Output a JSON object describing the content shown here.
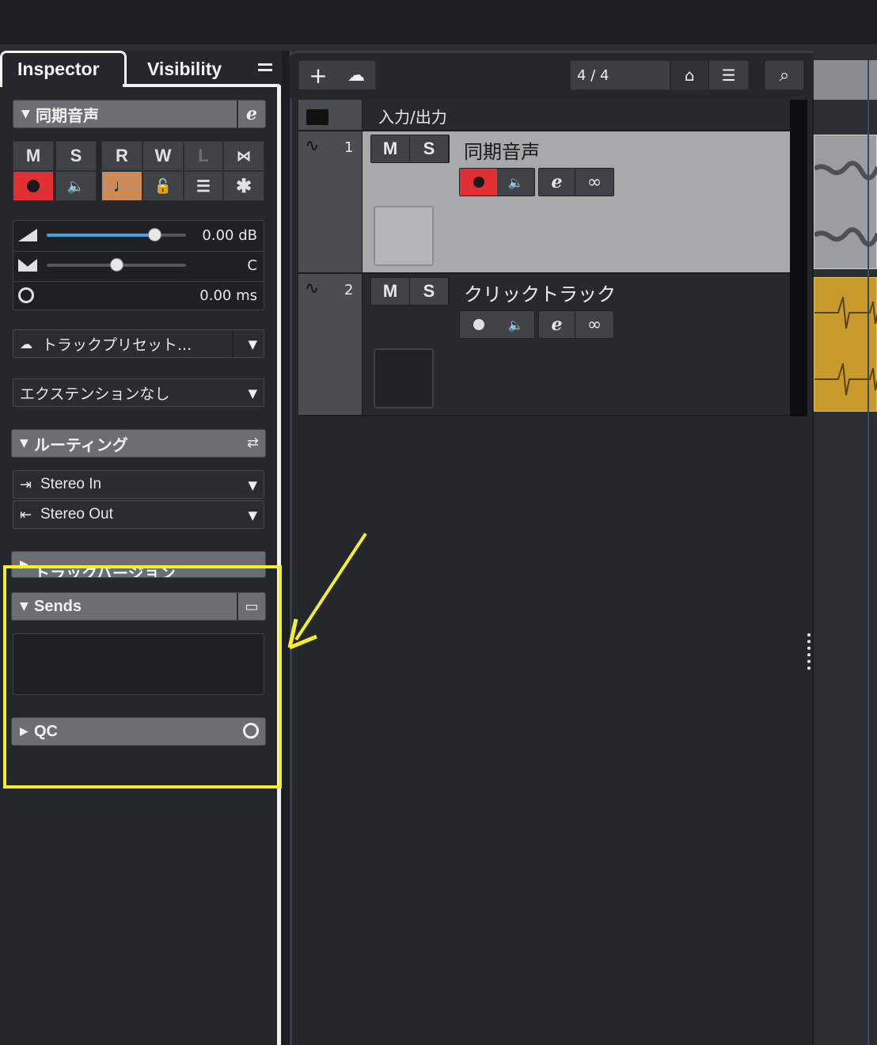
{
  "inspector": {
    "tabs": [
      {
        "label": "Inspector"
      },
      {
        "label": "Visibility"
      }
    ],
    "track_name": "同期音声",
    "buttons_top": [
      "M",
      "S",
      "R",
      "W",
      "L"
    ],
    "volume": "0.00 dB",
    "pan": "C",
    "delay": "0.00 ms",
    "volume_level": 0.77,
    "pan_level": 0.5,
    "track_preset": "トラックプリセット...",
    "extension": "エクステンションなし",
    "routing": {
      "title": "ルーティング",
      "input": "Stereo In",
      "output": "Stereo Out"
    },
    "track_versions": "トラックバージョン",
    "sends": "Sends",
    "qc": "QC"
  },
  "project": {
    "signature": "4 / 4",
    "folder_track": "入力/出力",
    "tracks": [
      {
        "number": "1",
        "name": "同期音声",
        "selected": true
      },
      {
        "number": "2",
        "name": "クリックトラック",
        "selected": false
      }
    ],
    "ms": [
      "M",
      "S"
    ]
  },
  "colors": {
    "record_red": "#e03033",
    "accent_orange": "#cc8a56",
    "annotation_yellow": "#f3ef2a",
    "clip_gold": "#c89a2c",
    "volume_blue": "#4aa0e6"
  }
}
